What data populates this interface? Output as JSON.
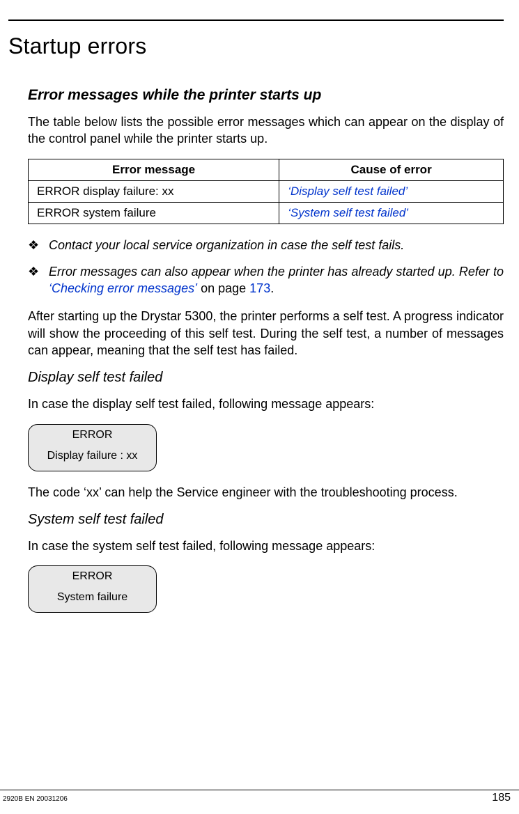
{
  "title": "Startup errors",
  "section": {
    "heading": "Error messages while the printer starts up",
    "intro": "The table below lists the possible error messages which can appear on the display of the control panel while the printer starts up.",
    "table": {
      "headers": [
        "Error message",
        "Cause of error"
      ],
      "rows": [
        {
          "msg": "ERROR display failure: xx",
          "cause": "‘Display self test failed’"
        },
        {
          "msg": "ERROR system failure",
          "cause": "‘System self test failed’"
        }
      ]
    },
    "bullets": [
      {
        "text": "Contact your local service organization in case the self test fails."
      },
      {
        "pre": "Error messages can also appear when the printer has already started up. Refer to ",
        "link": "‘Checking error messages’",
        "mid": " on page ",
        "pageref": "173",
        "post": "."
      }
    ],
    "after_para": "After starting up the Drystar 5300, the printer performs a self test. A progress indicator will show the proceeding of this self test. During the self test, a number of messages can appear, meaning that the self test has failed.",
    "sub1": {
      "heading": "Display self test failed",
      "intro": "In case the display self test failed, following message appears:",
      "lcd": {
        "line1": "ERROR",
        "line2": "Display failure : xx"
      },
      "note": "The code ‘xx’ can help the Service engineer with the troubleshooting process."
    },
    "sub2": {
      "heading": "System self test failed",
      "intro": "In case the system self test failed, following message appears:",
      "lcd": {
        "line1": "ERROR",
        "line2": "System failure"
      }
    }
  },
  "footer": {
    "docid": "2920B EN 20031206",
    "pagenum": "185"
  }
}
